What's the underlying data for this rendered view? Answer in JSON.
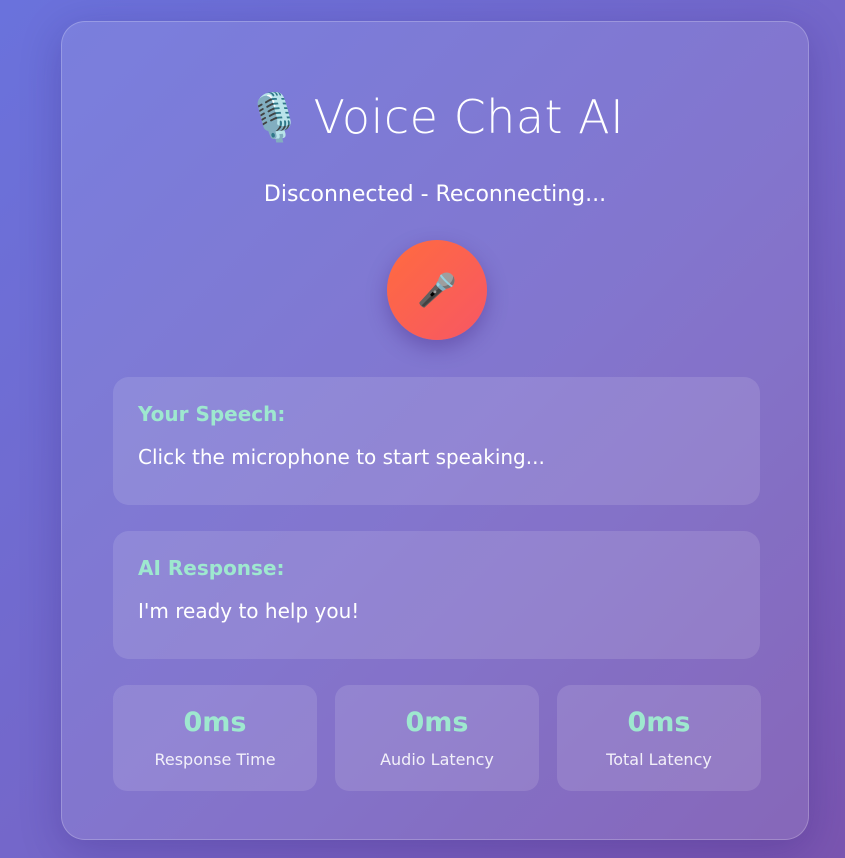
{
  "app": {
    "title": "Voice Chat AI",
    "title_icon": "🎙️",
    "status": "Disconnected - Reconnecting..."
  },
  "mic_button": {
    "icon": "🎤",
    "icon_name": "microphone-icon",
    "color": "#ff6b3f"
  },
  "speech_panel": {
    "label": "Your Speech:",
    "text": "Click the microphone to start speaking..."
  },
  "response_panel": {
    "label": "AI Response:",
    "text": "I'm ready to help you!"
  },
  "metrics": [
    {
      "value": "0ms",
      "label": "Response Time"
    },
    {
      "value": "0ms",
      "label": "Audio Latency"
    },
    {
      "value": "0ms",
      "label": "Total Latency"
    }
  ],
  "colors": {
    "accent": "#9ee8cf",
    "background_start": "#6a72dc",
    "background_end": "#7a55b0"
  }
}
